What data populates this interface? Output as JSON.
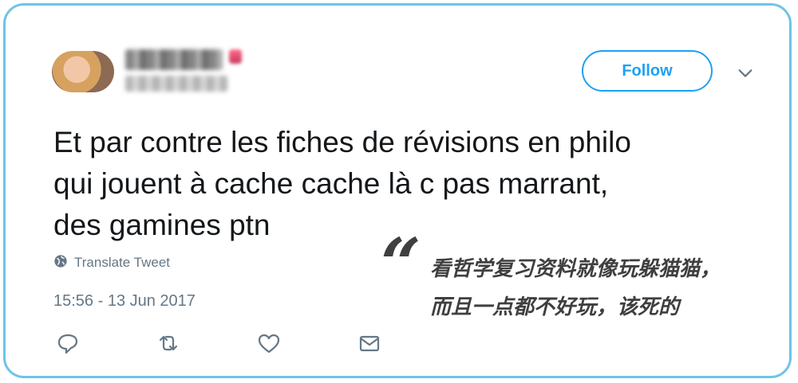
{
  "tweet": {
    "follow_label": "Follow",
    "text_lines": [
      "Et par contre les fiches de révisions en philo",
      "qui jouent à cache cache là c pas marrant,",
      "des gamines ptn"
    ],
    "translate_label": "Translate Tweet",
    "timestamp": "15:56 - 13 Jun 2017",
    "translation_lines": [
      "看哲学复习资料就像玩躲猫猫，",
      "而且一点都不好玩，该死的"
    ],
    "quote_mark": "“"
  },
  "colors": {
    "border": "#6ec3ea",
    "accent": "#1da1f2",
    "muted": "#657786",
    "text": "#14171a"
  },
  "icons": [
    "globe-icon",
    "reply-icon",
    "retweet-icon",
    "like-icon",
    "message-icon",
    "chevron-down-icon"
  ]
}
